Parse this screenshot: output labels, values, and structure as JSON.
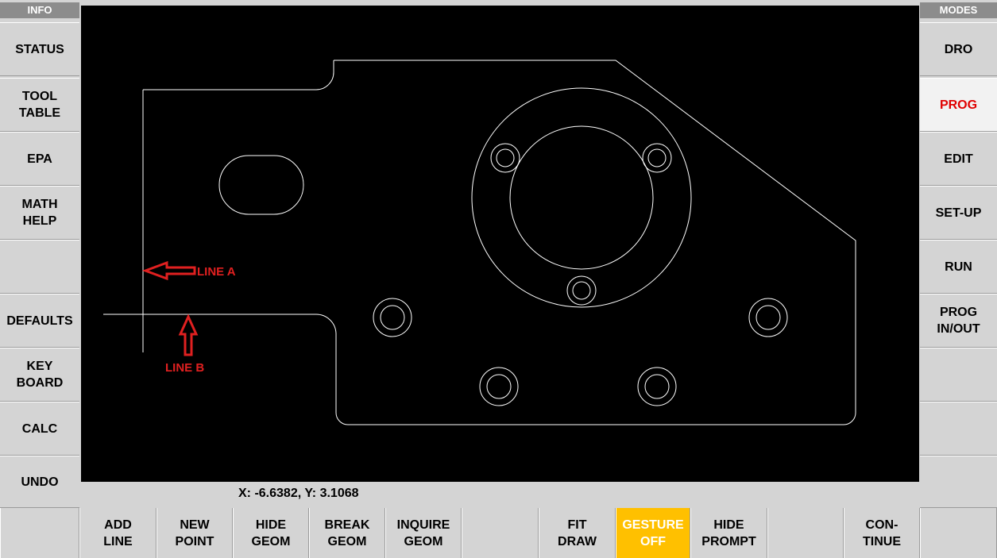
{
  "left_panel": {
    "header": "INFO",
    "buttons": [
      {
        "label": "STATUS"
      },
      {
        "label": "TOOL\nTABLE"
      },
      {
        "label": "EPA"
      },
      {
        "label": "MATH\nHELP"
      },
      {
        "label": ""
      },
      {
        "label": "DEFAULTS"
      },
      {
        "label": "KEY\nBOARD"
      },
      {
        "label": "CALC"
      },
      {
        "label": "UNDO"
      }
    ]
  },
  "right_panel": {
    "header": "MODES",
    "buttons": [
      {
        "label": "DRO"
      },
      {
        "label": "PROG",
        "active": true
      },
      {
        "label": "EDIT"
      },
      {
        "label": "SET-UP"
      },
      {
        "label": "RUN"
      },
      {
        "label": "PROG\nIN/OUT"
      },
      {
        "label": ""
      },
      {
        "label": ""
      },
      {
        "label": ""
      }
    ]
  },
  "coordinate_readout": "X: -6.6382, Y: 3.1068",
  "annotations": {
    "line_a": "LINE A",
    "line_b": "LINE B"
  },
  "bottom_bar": {
    "buttons": [
      {
        "label": ""
      },
      {
        "label": "ADD\nLINE"
      },
      {
        "label": "NEW\nPOINT"
      },
      {
        "label": "HIDE\nGEOM"
      },
      {
        "label": "BREAK\nGEOM"
      },
      {
        "label": "INQUIRE\nGEOM"
      },
      {
        "label": ""
      },
      {
        "label": "FIT\nDRAW"
      },
      {
        "label": "GESTURE\nOFF",
        "active": true
      },
      {
        "label": "HIDE\nPROMPT"
      },
      {
        "label": ""
      },
      {
        "label": "CON-\nTINUE"
      },
      {
        "label": ""
      }
    ]
  },
  "colors": {
    "active_mode_text": "#e00000",
    "gesture_active_bg": "#ffc000",
    "annotation": "#e02020"
  }
}
